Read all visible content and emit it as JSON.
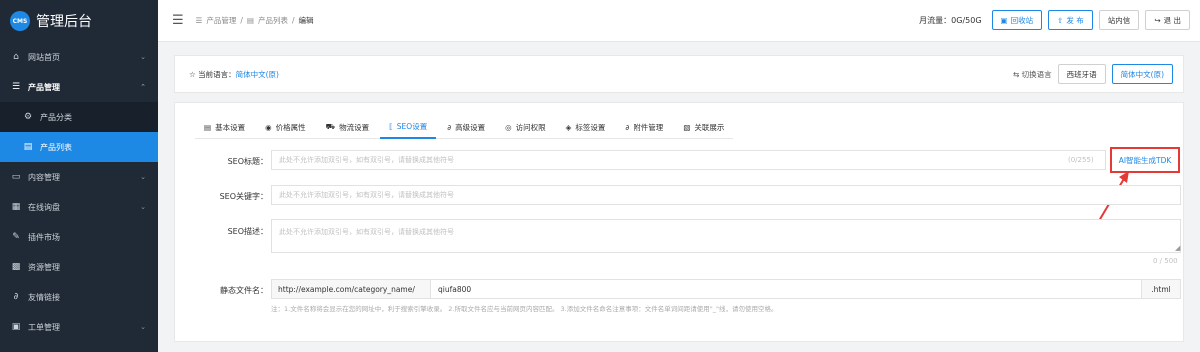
{
  "brand": {
    "logo_text": "CMS",
    "title": "管理后台"
  },
  "sidebar": {
    "items": [
      {
        "icon": "⌂",
        "label": "网站首页",
        "chevron": "⌄"
      },
      {
        "icon": "☰",
        "label": "产品管理",
        "chevron": "⌃"
      },
      {
        "icon": "⚙",
        "label": "产品分类"
      },
      {
        "icon": "▤",
        "label": "产品列表"
      },
      {
        "icon": "▭",
        "label": "内容管理",
        "chevron": "⌄"
      },
      {
        "icon": "▦",
        "label": "在线询盘",
        "chevron": "⌄"
      },
      {
        "icon": "✎",
        "label": "插件市场"
      },
      {
        "icon": "▩",
        "label": "资源管理"
      },
      {
        "icon": "∂",
        "label": "友情链接"
      },
      {
        "icon": "▣",
        "label": "工单管理",
        "chevron": "⌄"
      }
    ]
  },
  "topbar": {
    "menu_icon": "☰",
    "breadcrumb": [
      {
        "icon": "☰",
        "label": "产品管理"
      },
      {
        "sep": "/"
      },
      {
        "icon": "▤",
        "label": "产品列表"
      },
      {
        "sep2": "/"
      },
      {
        "label": "编辑"
      }
    ],
    "traffic": "月流量：0G/50G",
    "recycle_icon": "▣",
    "recycle": "回收站",
    "publish_icon": "⇧",
    "publish": "发 布",
    "messages": "站内信",
    "logout_icon": "↪",
    "logout": "退 出"
  },
  "language": {
    "current_label": "☆ 当前语言：",
    "current_value": "简体中文(原)",
    "switch_label": "⇆ 切换语言",
    "options": [
      "西班牙语",
      "简体中文(原)"
    ]
  },
  "tabs": [
    {
      "icon": "▤",
      "label": "基本设置"
    },
    {
      "icon": "◉",
      "label": "价格属性"
    },
    {
      "icon": "⛟",
      "label": "物流设置"
    },
    {
      "icon": "⟦",
      "label": "SEO设置"
    },
    {
      "icon": "∂",
      "label": "高级设置"
    },
    {
      "icon": "◎",
      "label": "访问权限"
    },
    {
      "icon": "◈",
      "label": "标签设置"
    },
    {
      "icon": "∂",
      "label": "附件管理"
    },
    {
      "icon": "▧",
      "label": "关联展示"
    }
  ],
  "seo": {
    "title_label": "SEO标题：",
    "title_placeholder": "此处不允许添加双引号，如有双引号，请替换成其他符号",
    "title_counter": "(0/255)",
    "ai_button": "AI智能生成TDK",
    "keywords_label": "SEO关键字：",
    "keywords_placeholder": "此处不允许添加双引号，如有双引号，请替换成其他符号",
    "desc_label": "SEO描述：",
    "desc_placeholder": "此处不允许添加双引号，如有双引号，请替换成其他符号",
    "desc_counter": "0 / 500",
    "resize_icon": "◢",
    "static_label": "静态文件名：",
    "url_prefix": "http://example.com/category_name/",
    "url_value": "qiufa800",
    "url_suffix": ".html",
    "hint": "注：1.文件名称将会显示在您的网址中，利于搜索引擎收录。 2.所取文件名应与当前网页内容匹配。 3.添加文件名命名注意事项：文件名单词间距请使用\"_\"线，请勿使用空格。"
  },
  "colors": {
    "accent": "#1e88e5",
    "sidebar_bg": "#1f2a36",
    "highlight": "#e53935"
  }
}
